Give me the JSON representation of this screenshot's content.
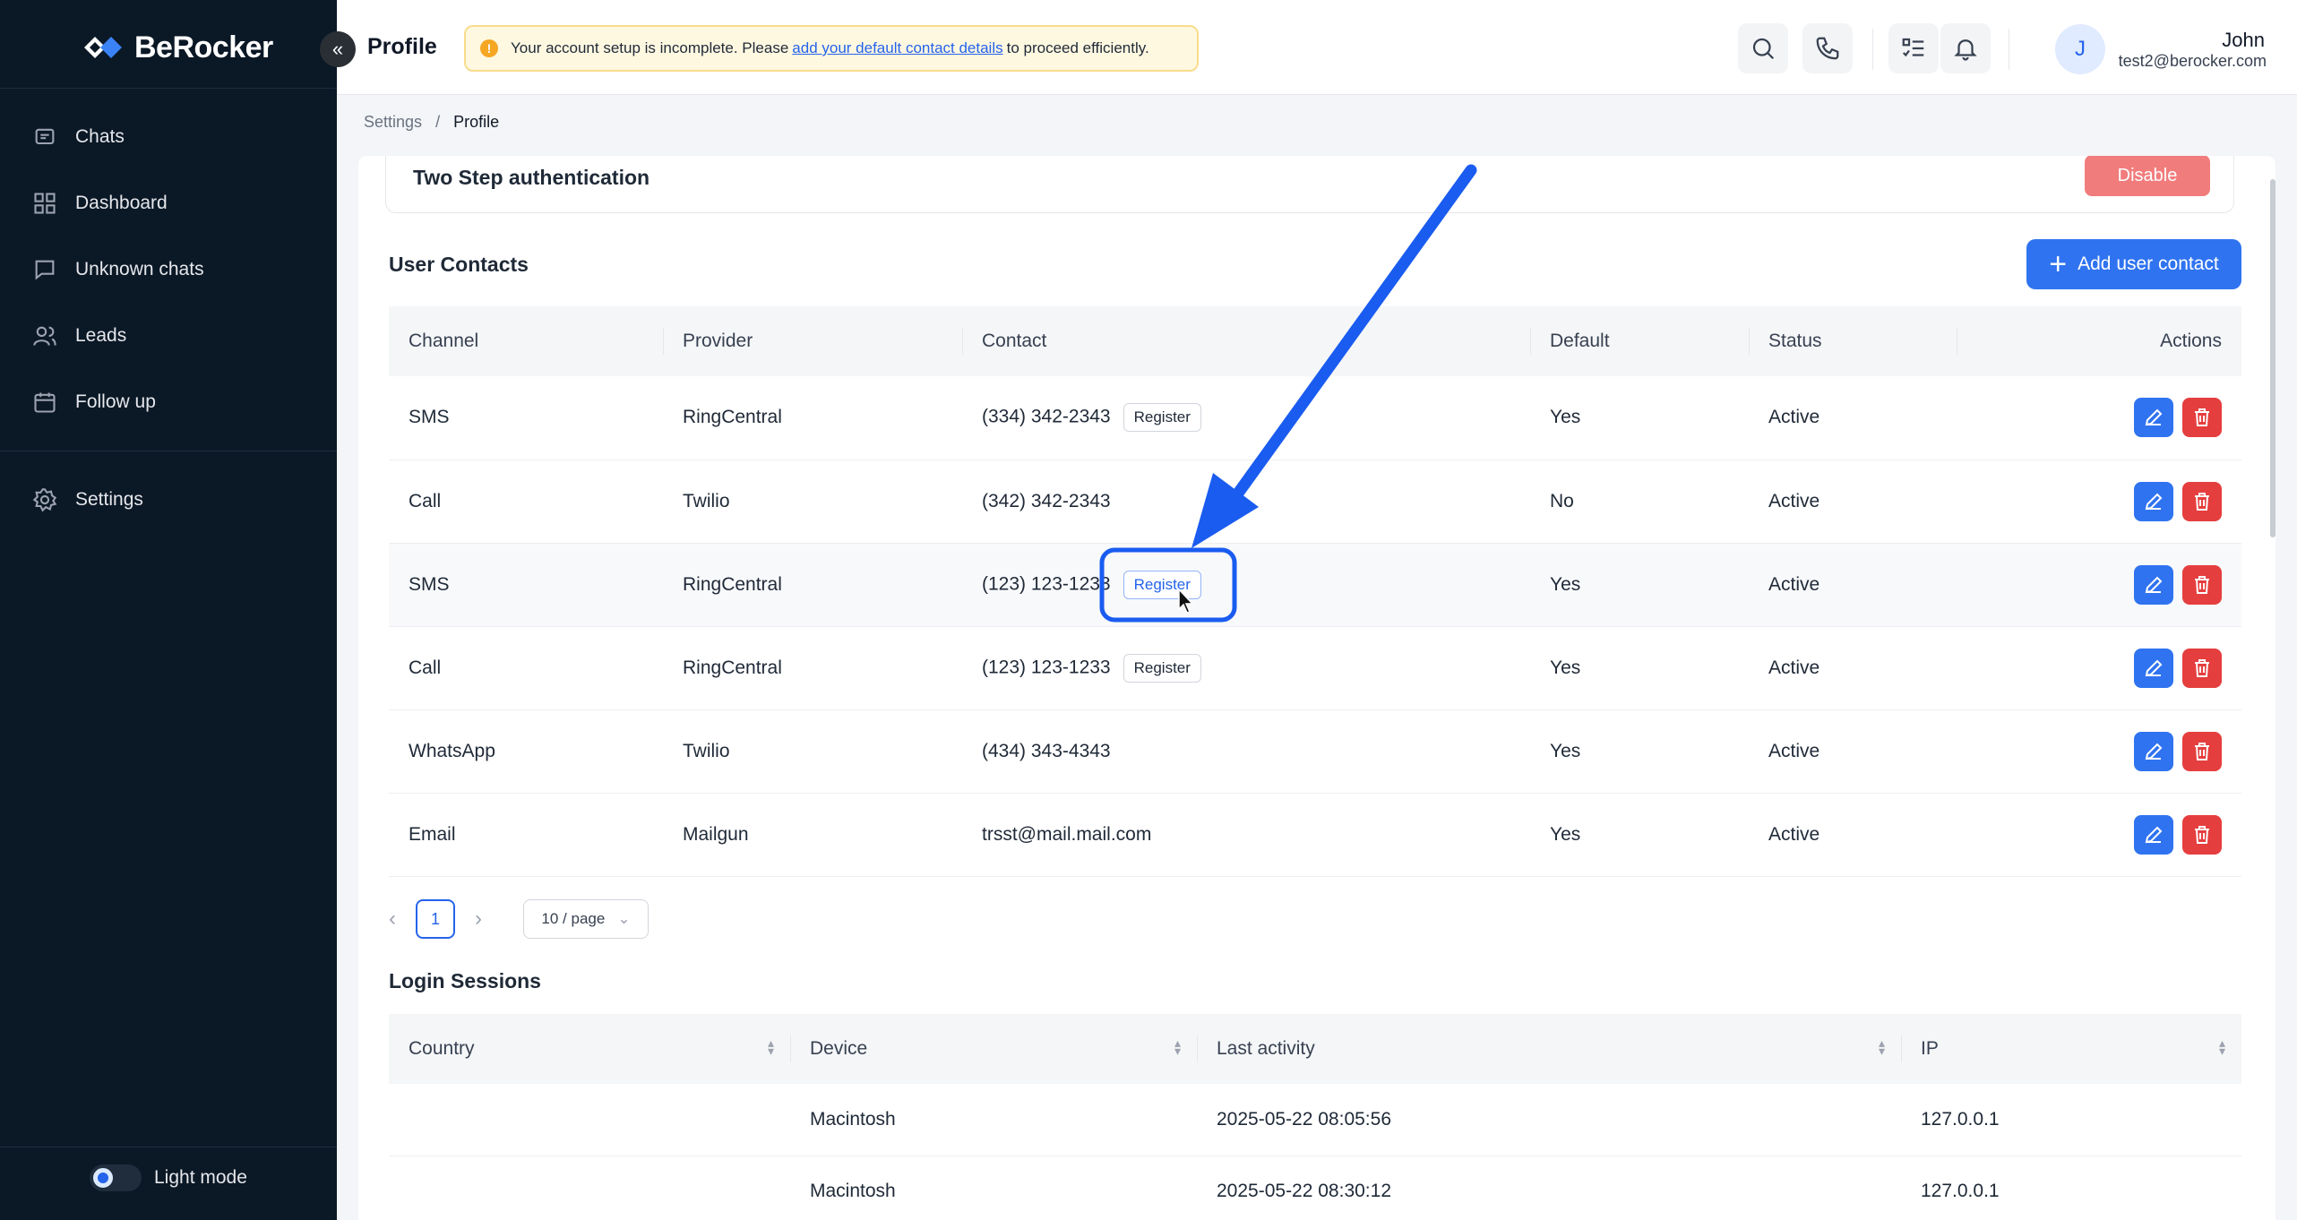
{
  "brand": {
    "name": "BeRocker"
  },
  "sidebar": {
    "items": [
      {
        "label": "Chats",
        "icon": "chat-icon"
      },
      {
        "label": "Dashboard",
        "icon": "dashboard-icon"
      },
      {
        "label": "Unknown chats",
        "icon": "message-square-icon"
      },
      {
        "label": "Leads",
        "icon": "users-icon"
      },
      {
        "label": "Follow up",
        "icon": "calendar-icon"
      },
      {
        "label": "Settings",
        "icon": "gear-icon"
      }
    ],
    "mode_label": "Light mode"
  },
  "header": {
    "title": "Profile",
    "alert": {
      "before": "Your account setup is incomplete. Please",
      "link": "add your default contact details",
      "after": "to proceed efficiently."
    },
    "user": {
      "initial": "J",
      "name": "John",
      "email": "test2@berocker.com"
    }
  },
  "breadcrumb": {
    "parent": "Settings",
    "separator": "/",
    "current": "Profile"
  },
  "two_step": {
    "title": "Two Step authentication",
    "button": "Disable"
  },
  "user_contacts": {
    "title": "User Contacts",
    "add_button": "Add user contact",
    "columns": [
      "Channel",
      "Provider",
      "Contact",
      "Default",
      "Status",
      "Actions"
    ],
    "register_label": "Register",
    "rows": [
      {
        "channel": "SMS",
        "provider": "RingCentral",
        "contact": "(334) 342-2343",
        "default": "Yes",
        "status": "Active"
      },
      {
        "channel": "Call",
        "provider": "Twilio",
        "contact": "(342) 342-2343",
        "default": "No",
        "status": "Active"
      },
      {
        "channel": "SMS",
        "provider": "RingCentral",
        "contact": "(123) 123-1233",
        "default": "Yes",
        "status": "Active"
      },
      {
        "channel": "Call",
        "provider": "RingCentral",
        "contact": "(123) 123-1233",
        "default": "Yes",
        "status": "Active"
      },
      {
        "channel": "WhatsApp",
        "provider": "Twilio",
        "contact": "(434) 343-4343",
        "default": "Yes",
        "status": "Active"
      },
      {
        "channel": "Email",
        "provider": "Mailgun",
        "contact": "trsst@mail.mail.com",
        "default": "Yes",
        "status": "Active"
      }
    ],
    "pagination": {
      "prev": "‹",
      "page": "1",
      "next": "›",
      "page_size": "10 / page"
    }
  },
  "login_sessions": {
    "title": "Login Sessions",
    "columns": [
      "Country",
      "Device",
      "Last activity",
      "IP"
    ],
    "rows": [
      {
        "country": "",
        "device": "Macintosh",
        "last_activity": "2025-05-22 08:05:56",
        "ip": "127.0.0.1"
      },
      {
        "country": "",
        "device": "Macintosh",
        "last_activity": "2025-05-22 08:30:12",
        "ip": "127.0.0.1"
      }
    ]
  },
  "colors": {
    "sidebar_bg": "#0b1826",
    "primary": "#2f73f0",
    "danger": "#e53e3e",
    "annotation": "#1a5cf0"
  }
}
